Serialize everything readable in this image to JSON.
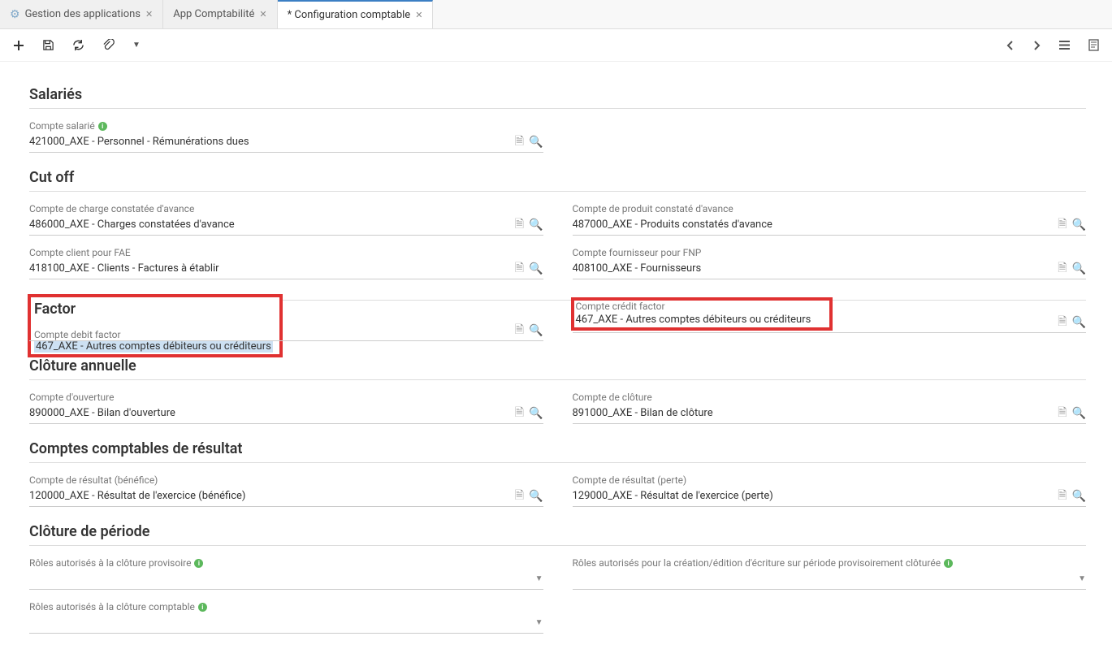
{
  "tabs": [
    {
      "label": "Gestion des applications",
      "hasGear": true
    },
    {
      "label": "App Comptabilité",
      "hasGear": false
    },
    {
      "label": "* Configuration comptable",
      "hasGear": false,
      "active": true
    }
  ],
  "sections": {
    "salaries": {
      "title": "Salariés",
      "compte_salarie": {
        "label": "Compte salarié",
        "value": "421000_AXE - Personnel - Rémunérations dues"
      }
    },
    "cutoff": {
      "title": "Cut off",
      "charge_avance": {
        "label": "Compte de charge constatée d'avance",
        "value": "486000_AXE - Charges constatées d'avance"
      },
      "produit_avance": {
        "label": "Compte de produit constaté d'avance",
        "value": "487000_AXE - Produits constatés d'avance"
      },
      "client_fae": {
        "label": "Compte client pour FAE",
        "value": "418100_AXE - Clients - Factures à établir"
      },
      "fournisseur_fnp": {
        "label": "Compte fournisseur pour FNP",
        "value": "408100_AXE - Fournisseurs"
      }
    },
    "factor": {
      "title": "Factor",
      "debit": {
        "label": "Compte debit factor",
        "value": "467_AXE - Autres comptes débiteurs ou créditeurs"
      },
      "credit": {
        "label": "Compte crédit factor",
        "value": "467_AXE - Autres comptes débiteurs ou créditeurs"
      }
    },
    "cloture_annuelle": {
      "title": "Clôture annuelle",
      "ouverture": {
        "label": "Compte d'ouverture",
        "value": "890000_AXE - Bilan d'ouverture"
      },
      "cloture": {
        "label": "Compte de clôture",
        "value": "891000_AXE - Bilan de clôture"
      }
    },
    "resultat": {
      "title": "Comptes comptables de résultat",
      "benefice": {
        "label": "Compte de résultat (bénéfice)",
        "value": "120000_AXE - Résultat de l'exercice (bénéfice)"
      },
      "perte": {
        "label": "Compte de résultat (perte)",
        "value": "129000_AXE - Résultat de l'exercice (perte)"
      }
    },
    "cloture_periode": {
      "title": "Clôture de période",
      "roles_provisoire": {
        "label": "Rôles autorisés à la clôture provisoire"
      },
      "roles_edition": {
        "label": "Rôles autorisés pour la création/édition d'écriture sur période provisoirement clôturée"
      },
      "roles_comptable": {
        "label": "Rôles autorisés à la clôture comptable"
      }
    }
  }
}
